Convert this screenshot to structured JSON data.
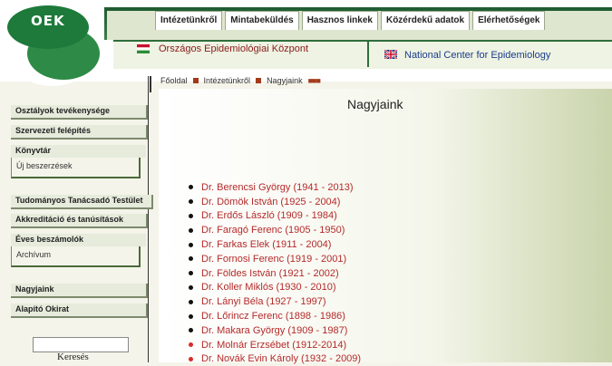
{
  "header": {
    "logo_text": "OEK",
    "top_nav": [
      "Intézetünkről",
      "Mintabeküldés",
      "Hasznos linkek",
      "Közérdekű adatok",
      "Elérhetőségek"
    ],
    "hu_title": "Országos Epidemiológiai Központ",
    "en_title": "National Center for Epidemiology"
  },
  "breadcrumb": {
    "items": [
      "Főoldal",
      "Intézetünkről",
      "Nagyjaink"
    ],
    "trail": "■■■"
  },
  "sidebar": {
    "items": [
      "Osztályok tevékenysége",
      "Szervezeti felépítés",
      "Könyvtár",
      "Új beszerzések",
      "Tudományos Tanácsadó Testület",
      "Akkreditáció és tanúsítások",
      "Éves beszámolók",
      "Archívum",
      "Nagyjaink",
      "Alapító Okirat"
    ],
    "search_label": "Keresés"
  },
  "content": {
    "title": "Nagyjaink",
    "people": [
      "Dr. Berencsi György (1941 - 2013)",
      "Dr. Dömök István (1925 - 2004)",
      "Dr. Erdős László (1909 - 1984)",
      "Dr. Faragó Ferenc (1905 - 1950)",
      "Dr. Farkas Elek (1911 - 2004)",
      "Dr. Fornosi Ferenc (1919 - 2001)",
      "Dr. Földes István (1921 - 2002)",
      "Dr. Koller Miklós (1930 - 2010)",
      "Dr. Lányi Béla (1927 - 1997)",
      "Dr. Lőrincz Ferenc (1898 - 1986)",
      "Dr. Makara György (1909 - 1987)",
      "Dr. Molnár Erzsébet (1912-2014)",
      "Dr. Novák Evin Károly (1932 - 2009)"
    ]
  }
}
